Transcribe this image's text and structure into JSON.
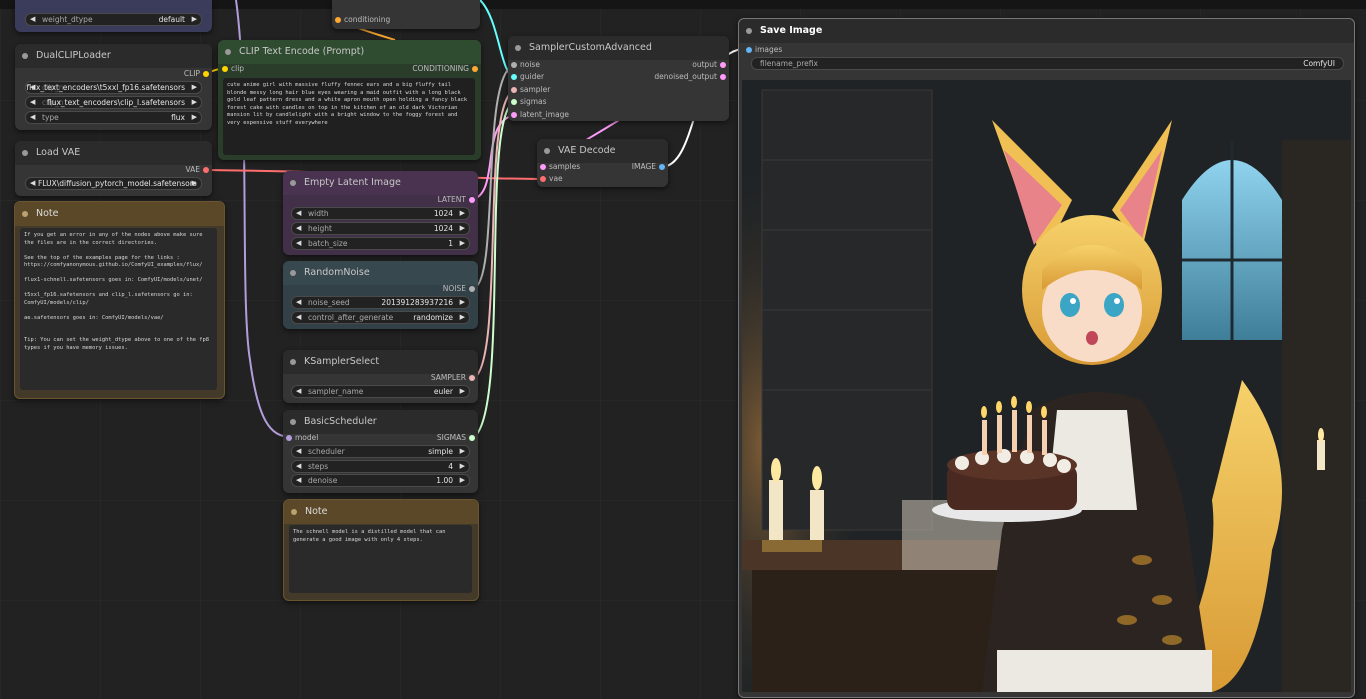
{
  "colors": {
    "canvas": "#222222",
    "node": "#353535",
    "clip_node": "#2a3d2b",
    "latent_node": "#413047",
    "noise_node": "#324047",
    "note_node": "#433a2a",
    "link_clip": "#ffd500",
    "link_conditioning": "#ffa931",
    "link_model": "#b39ddb",
    "link_vae": "#ff6e6e",
    "link_latent": "#ff9cf9",
    "link_image": "#64b5f6",
    "link_noise": "#b0b0b0",
    "link_sampler": "#ecb4b4",
    "link_sigmas": "#cdffcd",
    "link_guider": "#66ffff"
  },
  "top_partial": {
    "weight_dtype_label": "weight_dtype",
    "weight_dtype_value": "default",
    "conditioning_label": "conditioning"
  },
  "dualclip": {
    "title": "DualCLIPLoader",
    "output_clip": "CLIP",
    "clip_name1_label": "clip_n",
    "clip_name1_value": "flux_text_encoders\\t5xxl_fp16.safetensors",
    "clip_name2_label": "clip_n",
    "clip_name2_value": "flux_text_encoders\\clip_l.safetensors",
    "type_label": "type",
    "type_value": "flux"
  },
  "loadvae": {
    "title": "Load VAE",
    "output_vae": "VAE",
    "vae_value": "FLUX\\diffusion_pytorch_model.safetensors"
  },
  "note1": {
    "title": "Note",
    "text": "If you get an error in any of the nodes above make sure the files are in the correct directories.\n\nSee the top of the examples page for the links : https://comfyanonymous.github.io/ComfyUI_examples/flux/\n\nflux1-schnell.safetensors goes in: ComfyUI/models/unet/\n\nt5xxl_fp16.safetensors and clip_l.safetensors go in: ComfyUI/models/clip/\n\nae.safetensors goes in: ComfyUI/models/vae/\n\n\nTip: You can set the weight_dtype above to one of the fp8 types if you have memory issues."
  },
  "cliptext": {
    "title": "CLIP Text Encode (Prompt)",
    "input_clip": "clip",
    "output": "CONDITIONING",
    "text": "cute anime girl with massive fluffy fennec ears and a big fluffy tail blonde messy long hair blue eyes wearing a maid outfit with a long black gold leaf pattern dress and a white apron mouth open holding a fancy black forest cake with candles on top in the kitchen of an old dark Victorian mansion lit by candlelight with a bright window to the foggy forest and very expensive stuff everywhere"
  },
  "latent": {
    "title": "Empty Latent Image",
    "output": "LATENT",
    "width_label": "width",
    "width_value": "1024",
    "height_label": "height",
    "height_value": "1024",
    "batch_label": "batch_size",
    "batch_value": "1"
  },
  "noise": {
    "title": "RandomNoise",
    "output": "NOISE",
    "seed_label": "noise_seed",
    "seed_value": "201391283937216",
    "control_label": "control_after_generate",
    "control_value": "randomize"
  },
  "ksampler": {
    "title": "KSamplerSelect",
    "output": "SAMPLER",
    "sampler_label": "sampler_name",
    "sampler_value": "euler"
  },
  "scheduler": {
    "title": "BasicScheduler",
    "input_model": "model",
    "output": "SIGMAS",
    "scheduler_label": "scheduler",
    "scheduler_value": "simple",
    "steps_label": "steps",
    "steps_value": "4",
    "denoise_label": "denoise",
    "denoise_value": "1.00"
  },
  "note2": {
    "title": "Note",
    "text": "The schnell model is a distilled model that can generate a good image with only 4 steps."
  },
  "sampler_adv": {
    "title": "SamplerCustomAdvanced",
    "inputs": [
      "noise",
      "guider",
      "sampler",
      "sigmas",
      "latent_image"
    ],
    "output_label": "output",
    "denoised_label": "denoised_output"
  },
  "vaedecode": {
    "title": "VAE Decode",
    "input_samples": "samples",
    "input_vae": "vae",
    "output": "IMAGE"
  },
  "saveimage": {
    "title": "Save Image",
    "input_images": "images",
    "prefix_label": "filename_prefix",
    "prefix_value": "ComfyUI"
  }
}
